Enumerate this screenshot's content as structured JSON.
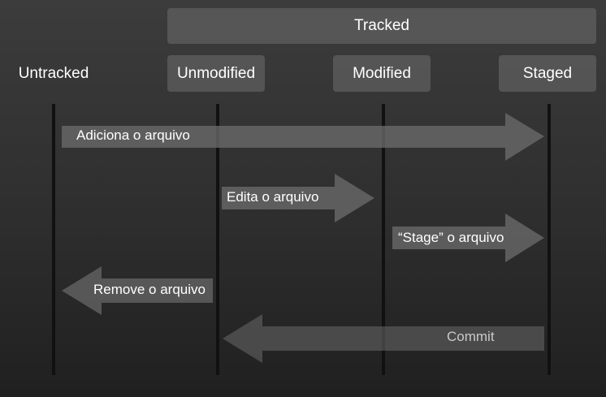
{
  "header": {
    "group_label": "Tracked"
  },
  "states": {
    "untracked": "Untracked",
    "unmodified": "Unmodified",
    "modified": "Modified",
    "staged": "Staged"
  },
  "transitions": [
    {
      "label": "Adiciona o arquivo",
      "from": "Untracked",
      "to": "Staged"
    },
    {
      "label": "Edita o arquivo",
      "from": "Unmodified",
      "to": "Modified"
    },
    {
      "label": "“Stage” o arquivo",
      "from": "Modified",
      "to": "Staged"
    },
    {
      "label": "Remove o arquivo",
      "from": "Unmodified",
      "to": "Untracked"
    },
    {
      "label": "Commit",
      "from": "Staged",
      "to": "Unmodified"
    }
  ],
  "colors": {
    "background_top": "#3c3c3c",
    "background_bottom": "#202020",
    "box_fill": "#6e6e6e",
    "arrow_fill": "#6a6a6a",
    "lifeline": "#111111",
    "text": "#ffffff"
  }
}
